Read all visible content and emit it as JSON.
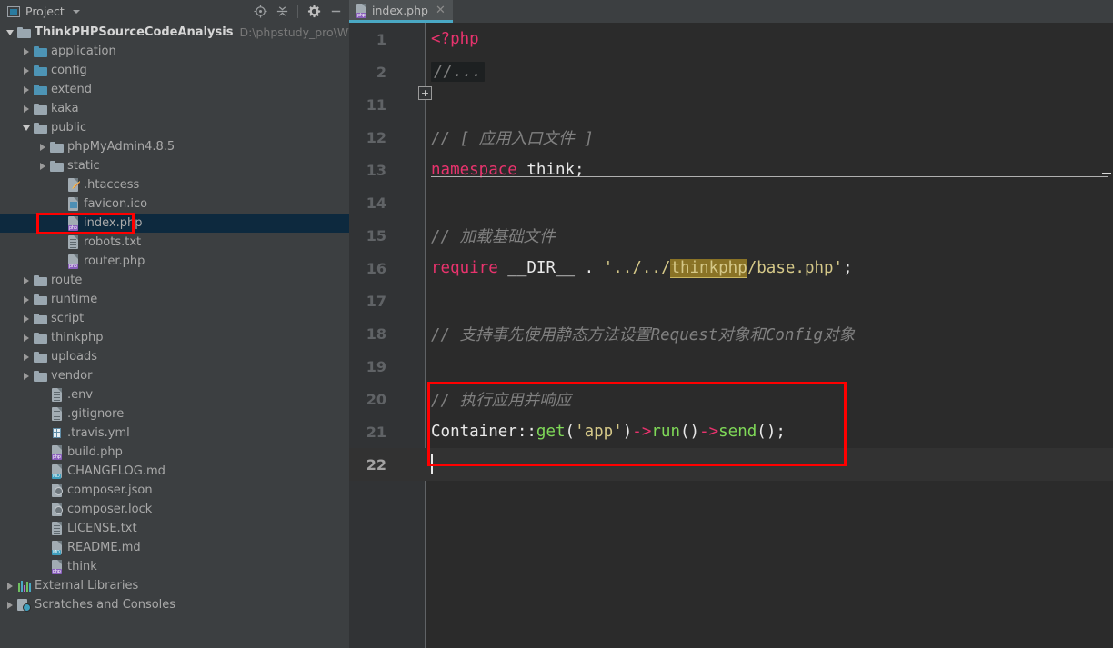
{
  "window": {
    "accent_color": "#4aa8c4",
    "annotation_color": "#ff0000",
    "panel_bg": "#3c3f41",
    "editor_bg": "#2b2b2b"
  },
  "project_panel": {
    "title": "Project",
    "title_icon": "project-window-icon",
    "dropdown_icon": "chevron-down-icon",
    "toolbar_buttons": [
      {
        "name": "locate-icon",
        "label": "Select Opened File"
      },
      {
        "name": "collapse-all-icon",
        "label": "Collapse All"
      },
      {
        "name": "gear-icon",
        "label": "Settings"
      },
      {
        "name": "minimize-icon",
        "label": "Hide"
      }
    ],
    "tree": [
      {
        "label": "ThinkPHPSourceCodeAnalysis",
        "sublabel": "D:\\phpstudy_pro\\WWW\\Th",
        "depth": 0,
        "icon": "folder-icon",
        "twisty": "expanded",
        "root": true
      },
      {
        "label": "application",
        "sublabel": "",
        "depth": 1,
        "icon": "folder-blue-icon",
        "twisty": "collapsed"
      },
      {
        "label": "config",
        "sublabel": "",
        "depth": 1,
        "icon": "folder-blue-icon",
        "twisty": "collapsed"
      },
      {
        "label": "extend",
        "sublabel": "",
        "depth": 1,
        "icon": "folder-blue-icon",
        "twisty": "collapsed"
      },
      {
        "label": "kaka",
        "sublabel": "",
        "depth": 1,
        "icon": "folder-icon",
        "twisty": "collapsed"
      },
      {
        "label": "public",
        "sublabel": "",
        "depth": 1,
        "icon": "folder-icon",
        "twisty": "expanded"
      },
      {
        "label": "phpMyAdmin4.8.5",
        "sublabel": "",
        "depth": 2,
        "icon": "folder-icon",
        "twisty": "collapsed"
      },
      {
        "label": "static",
        "sublabel": "",
        "depth": 2,
        "icon": "folder-icon",
        "twisty": "collapsed"
      },
      {
        "label": ".htaccess",
        "sublabel": "",
        "depth": 3,
        "icon": "file-htaccess-icon",
        "twisty": "none"
      },
      {
        "label": "favicon.ico",
        "sublabel": "",
        "depth": 3,
        "icon": "file-image-icon",
        "twisty": "none"
      },
      {
        "label": "index.php",
        "sublabel": "",
        "depth": 3,
        "icon": "file-php-icon",
        "twisty": "none",
        "selected": true,
        "annotated": true
      },
      {
        "label": "robots.txt",
        "sublabel": "",
        "depth": 3,
        "icon": "file-text-icon",
        "twisty": "none"
      },
      {
        "label": "router.php",
        "sublabel": "",
        "depth": 3,
        "icon": "file-php-icon",
        "twisty": "none"
      },
      {
        "label": "route",
        "sublabel": "",
        "depth": 1,
        "icon": "folder-icon",
        "twisty": "collapsed"
      },
      {
        "label": "runtime",
        "sublabel": "",
        "depth": 1,
        "icon": "folder-icon",
        "twisty": "collapsed"
      },
      {
        "label": "script",
        "sublabel": "",
        "depth": 1,
        "icon": "folder-icon",
        "twisty": "collapsed"
      },
      {
        "label": "thinkphp",
        "sublabel": "",
        "depth": 1,
        "icon": "folder-icon",
        "twisty": "collapsed"
      },
      {
        "label": "uploads",
        "sublabel": "",
        "depth": 1,
        "icon": "folder-icon",
        "twisty": "collapsed"
      },
      {
        "label": "vendor",
        "sublabel": "",
        "depth": 1,
        "icon": "folder-icon",
        "twisty": "collapsed"
      },
      {
        "label": ".env",
        "sublabel": "",
        "depth": 2,
        "icon": "file-text-icon",
        "twisty": "none"
      },
      {
        "label": ".gitignore",
        "sublabel": "",
        "depth": 2,
        "icon": "file-text-icon",
        "twisty": "none"
      },
      {
        "label": ".travis.yml",
        "sublabel": "",
        "depth": 2,
        "icon": "file-yaml-icon",
        "twisty": "none"
      },
      {
        "label": "build.php",
        "sublabel": "",
        "depth": 2,
        "icon": "file-php-icon",
        "twisty": "none"
      },
      {
        "label": "CHANGELOG.md",
        "sublabel": "",
        "depth": 2,
        "icon": "file-md-icon",
        "twisty": "none"
      },
      {
        "label": "composer.json",
        "sublabel": "",
        "depth": 2,
        "icon": "file-composer-icon",
        "twisty": "none"
      },
      {
        "label": "composer.lock",
        "sublabel": "",
        "depth": 2,
        "icon": "file-composer-icon",
        "twisty": "none"
      },
      {
        "label": "LICENSE.txt",
        "sublabel": "",
        "depth": 2,
        "icon": "file-text-icon",
        "twisty": "none"
      },
      {
        "label": "README.md",
        "sublabel": "",
        "depth": 2,
        "icon": "file-md-icon",
        "twisty": "none"
      },
      {
        "label": "think",
        "sublabel": "",
        "depth": 2,
        "icon": "file-php-icon",
        "twisty": "none"
      },
      {
        "label": "External Libraries",
        "sublabel": "",
        "depth": 0,
        "icon": "libraries-icon",
        "twisty": "collapsed"
      },
      {
        "label": "Scratches and Consoles",
        "sublabel": "",
        "depth": 0,
        "icon": "scratches-icon",
        "twisty": "collapsed"
      }
    ]
  },
  "editor": {
    "tabs": [
      {
        "label": "index.php",
        "icon": "file-php-icon",
        "active": true,
        "close_icon": "close-icon"
      }
    ],
    "fold_marker": "+",
    "lines": [
      {
        "num": "1",
        "tokens": [
          {
            "t": "<?php",
            "c": "php-tag"
          }
        ]
      },
      {
        "num": "2",
        "tokens": [
          {
            "t": "//...",
            "c": "folded"
          }
        ],
        "fold": true
      },
      {
        "num": "11",
        "tokens": []
      },
      {
        "num": "12",
        "tokens": [
          {
            "t": "// [ 应用入口文件 ]",
            "c": "cmt"
          }
        ]
      },
      {
        "num": "13",
        "tokens": [
          {
            "t": "namespace",
            "c": "pink"
          },
          {
            "t": " think;",
            "c": "plain"
          }
        ]
      },
      {
        "num": "14",
        "tokens": []
      },
      {
        "num": "15",
        "tokens": [
          {
            "t": "// 加载基础文件",
            "c": "cmt"
          }
        ]
      },
      {
        "num": "16",
        "tokens": [
          {
            "t": "require",
            "c": "pink"
          },
          {
            "t": " __DIR__ ",
            "c": "plain"
          },
          {
            "t": ". ",
            "c": "plain"
          },
          {
            "t": "'../../",
            "c": "str"
          },
          {
            "t": "thinkphp",
            "c": "hl-ident"
          },
          {
            "t": "/base.php'",
            "c": "str"
          },
          {
            "t": ";",
            "c": "plain"
          }
        ]
      },
      {
        "num": "17",
        "tokens": []
      },
      {
        "num": "18",
        "tokens": [
          {
            "t": "// 支持事先使用静态方法设置Request对象和Config对象",
            "c": "cmt"
          }
        ]
      },
      {
        "num": "19",
        "tokens": []
      },
      {
        "num": "20",
        "tokens": [
          {
            "t": "// 执行应用并响应",
            "c": "cmt"
          }
        ]
      },
      {
        "num": "21",
        "tokens": [
          {
            "t": "Container",
            "c": "plain"
          },
          {
            "t": "::",
            "c": "plain"
          },
          {
            "t": "get",
            "c": "fn"
          },
          {
            "t": "(",
            "c": "plain"
          },
          {
            "t": "'app'",
            "c": "str"
          },
          {
            "t": ")",
            "c": "plain"
          },
          {
            "t": "->",
            "c": "arrow"
          },
          {
            "t": "run",
            "c": "fn"
          },
          {
            "t": "()",
            "c": "plain"
          },
          {
            "t": "->",
            "c": "arrow"
          },
          {
            "t": "send",
            "c": "fn"
          },
          {
            "t": "()",
            "c": "plain"
          },
          {
            "t": ";",
            "c": "plain"
          }
        ]
      },
      {
        "num": "22",
        "tokens": [],
        "current": true,
        "caret": true
      }
    ]
  }
}
